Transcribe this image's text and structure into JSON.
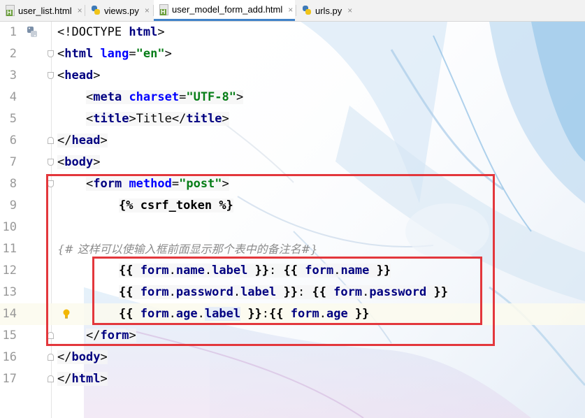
{
  "tabs": [
    {
      "label": "user_list.html",
      "icon": "html-file-icon",
      "active": false
    },
    {
      "label": "views.py",
      "icon": "python-file-icon",
      "active": false
    },
    {
      "label": "user_model_form_add.html",
      "icon": "html-file-icon",
      "active": true
    },
    {
      "label": "urls.py",
      "icon": "python-file-icon",
      "active": false
    }
  ],
  "close_glyph": "×",
  "line_numbers": [
    "1",
    "2",
    "3",
    "4",
    "5",
    "6",
    "7",
    "8",
    "9",
    "10",
    "11",
    "12",
    "13",
    "14",
    "15",
    "16",
    "17"
  ],
  "code": {
    "l1": {
      "a": "<!DOCTYPE ",
      "b": "html",
      "c": ">"
    },
    "l2": {
      "a": "<",
      "b": "html",
      "c": " lang",
      "d": "=",
      "e": "\"en\"",
      "f": ">"
    },
    "l3": {
      "a": "<",
      "b": "head",
      "c": ">"
    },
    "l4": {
      "a": "<",
      "b": "meta",
      "c": " charset",
      "d": "=",
      "e": "\"UTF-8\"",
      "f": ">"
    },
    "l5": {
      "a": "<",
      "b": "title",
      "c": ">",
      "d": "Title",
      "e": "</",
      "f": "title",
      "g": ">"
    },
    "l6": {
      "a": "</",
      "b": "head",
      "c": ">"
    },
    "l7": {
      "a": "<",
      "b": "body",
      "c": ">"
    },
    "l8": {
      "a": "<",
      "b": "form",
      "c": " method",
      "d": "=",
      "e": "\"post\"",
      "f": ">"
    },
    "l9": {
      "a": "{% ",
      "b": "csrf_token",
      "c": " %}"
    },
    "l11": {
      "a": "{# ",
      "b": "这样可以使输入框前面显示那个表中的备注名",
      "c": "#}"
    },
    "l12": {
      "a": "{{ ",
      "b": "form",
      "c": ".",
      "d": "name",
      "e": ".",
      "f": "label",
      "g": " }}",
      "h": ": ",
      "i": "{{ ",
      "j": "form",
      "k": ".",
      "l": "name",
      "m": " }}"
    },
    "l13": {
      "a": "{{ ",
      "b": "form",
      "c": ".",
      "d": "password",
      "e": ".",
      "f": "label",
      "g": " }}",
      "h": ": ",
      "i": "{{ ",
      "j": "form",
      "k": ".",
      "l": "password",
      "m": " }}"
    },
    "l14": {
      "a": "{{ ",
      "b": "form",
      "c": ".",
      "d": "age",
      "e": ".",
      "f": "label",
      "g": " }}",
      "h": ":",
      "i": "{{ ",
      "j": "form",
      "k": ".",
      "l": "age",
      "m": " }}"
    },
    "l15": {
      "a": "</",
      "b": "form",
      "c": ">"
    },
    "l16": {
      "a": "</",
      "b": "body",
      "c": ">"
    },
    "l17": {
      "a": "</",
      "b": "html",
      "c": ">"
    }
  },
  "colors": {
    "annotation_box": "#e3373c",
    "active_tab_underline": "#4083c9",
    "current_line": "#fcfaed"
  }
}
